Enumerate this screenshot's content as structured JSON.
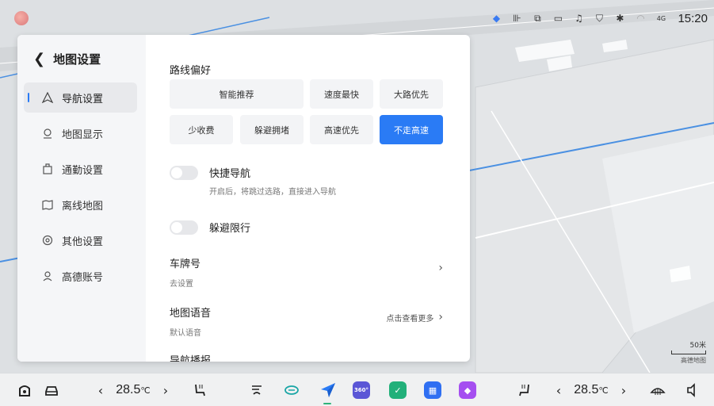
{
  "status_bar": {
    "time": "15:20",
    "icons": [
      "location-arrow-icon",
      "vibrate-icon",
      "screen-cast-icon",
      "camera-icon",
      "bell-icon",
      "shield-icon",
      "bluetooth-icon",
      "wifi-icon",
      "signal-icon"
    ],
    "signal_label": "4G"
  },
  "panel": {
    "title": "地图设置",
    "nav_items": [
      {
        "label": "导航设置",
        "icon": "navigation-icon",
        "active": true
      },
      {
        "label": "地图显示",
        "icon": "map-pin-icon",
        "active": false
      },
      {
        "label": "通勤设置",
        "icon": "commute-icon",
        "active": false
      },
      {
        "label": "离线地图",
        "icon": "offline-map-icon",
        "active": false
      },
      {
        "label": "其他设置",
        "icon": "gear-icon",
        "active": false
      },
      {
        "label": "高德账号",
        "icon": "user-icon",
        "active": false
      }
    ],
    "route_pref": {
      "title": "路线偏好",
      "options": [
        "智能推荐",
        "速度最快",
        "大路优先",
        "少收费",
        "躲避拥堵",
        "高速优先",
        "不走高速"
      ],
      "selected": "不走高速"
    },
    "quick_nav": {
      "title": "快捷导航",
      "desc": "开启后，将跳过选路，直接进入导航",
      "enabled": false
    },
    "avoid_restriction": {
      "title": "躲避限行",
      "enabled": false
    },
    "plate": {
      "title": "车牌号",
      "sub": "去设置"
    },
    "voice": {
      "title": "地图语音",
      "sub": "默认语音",
      "more": "点击查看更多"
    },
    "partial_item": "导航播报"
  },
  "map": {
    "scale_label": "50米",
    "brand": "高德地图",
    "colors": {
      "road_blue": "#4a90e2",
      "background": "#dde0e3",
      "accent": "#2a7bf5"
    }
  },
  "dock": {
    "left_temp": "28.5",
    "right_temp": "28.5",
    "temp_unit": "℃",
    "apps": [
      {
        "name": "navigation-app-icon",
        "color": "#2a7bf5"
      },
      {
        "name": "360-camera-app-icon",
        "label": "360°",
        "color": "#5b56d6"
      },
      {
        "name": "check-app-icon",
        "color": "#22b07a"
      },
      {
        "name": "grid-app-icon",
        "color": "#2f6ff2"
      },
      {
        "name": "media-app-icon",
        "color": "#a54ff0"
      }
    ]
  }
}
